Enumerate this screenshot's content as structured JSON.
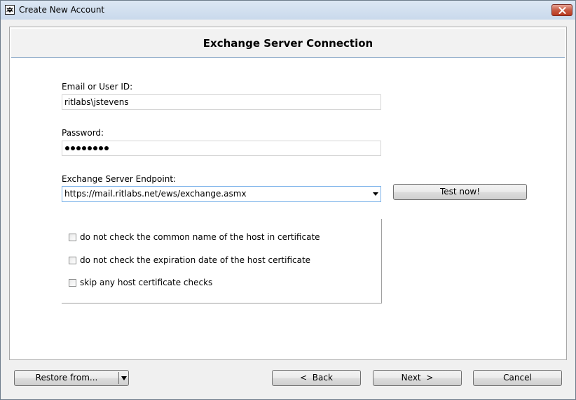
{
  "window": {
    "title": "Create New Account",
    "app_icon": "bat-icon",
    "close_icon": "close-icon"
  },
  "page": {
    "heading": "Exchange Server Connection"
  },
  "form": {
    "email_label": "Email or User ID:",
    "email_value": "ritlabs\\jstevens",
    "password_label": "Password:",
    "password_masked_length": 8,
    "endpoint_label": "Exchange Server Endpoint:",
    "endpoint_value": "https://mail.ritlabs.net/ews/exchange.asmx",
    "test_button": "Test now!"
  },
  "options": [
    {
      "label": "do not check the common name of the host in certificate",
      "checked": false
    },
    {
      "label": "do not check the expiration date of the host certificate",
      "checked": false
    },
    {
      "label": "skip any host certificate checks",
      "checked": false
    }
  ],
  "footer": {
    "restore_label": "Restore from...",
    "back_label": "<  Back",
    "next_label": "Next  >",
    "cancel_label": "Cancel"
  },
  "colors": {
    "title_bar": "#c9d9ec",
    "close_button": "#c75a43",
    "focus_border": "#7eb4ea",
    "header_rule": "#8aa8c8"
  }
}
